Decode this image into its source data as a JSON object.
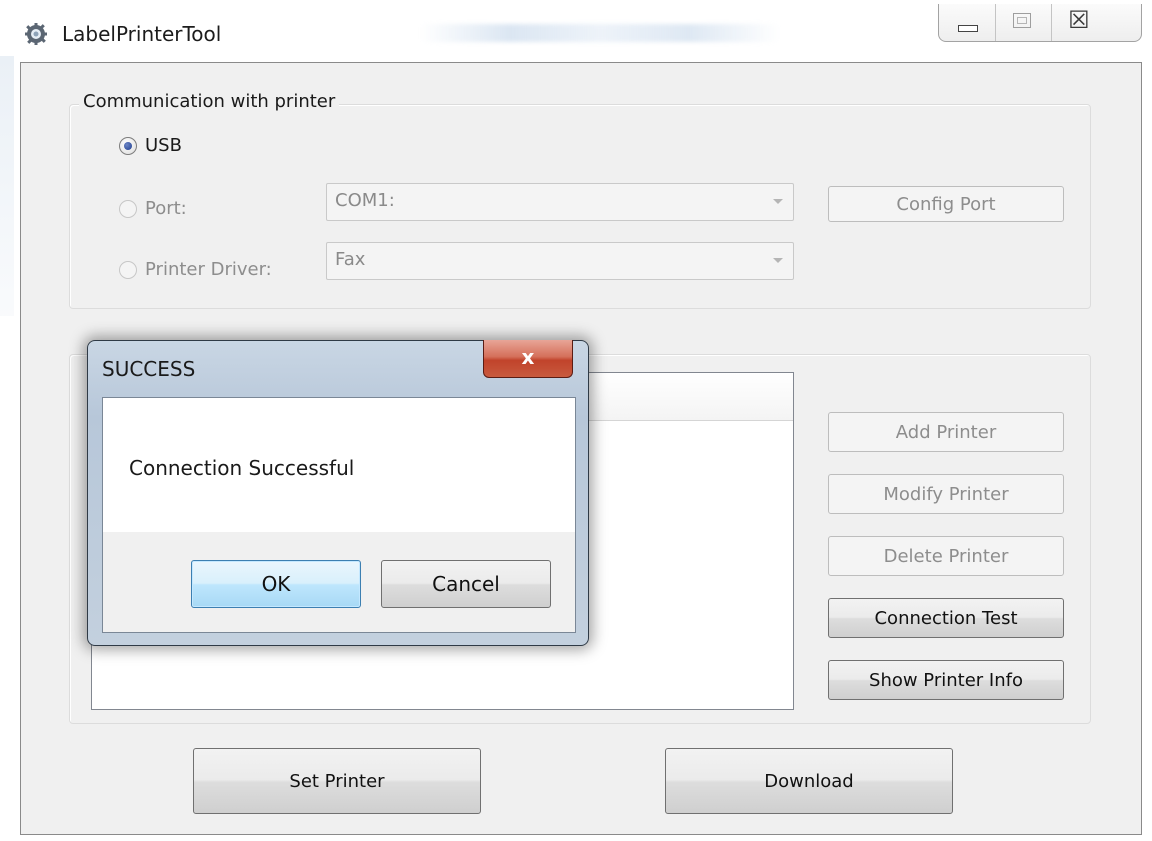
{
  "window": {
    "title": "LabelPrinterTool",
    "icon": "gear-icon",
    "caption_buttons": {
      "minimize_icon": "minimize-icon",
      "maximize_icon": "maximize-icon",
      "close_glyph": "☒"
    }
  },
  "communication": {
    "group_label": "Communication with printer",
    "usb_label": "USB",
    "port_label": "Port:",
    "port_value": "COM1:",
    "driver_label": "Printer Driver:",
    "driver_value": "Fax",
    "config_port_label": "Config Port",
    "selected": "USB"
  },
  "printers": {
    "add_label": "Add Printer",
    "modify_label": "Modify Printer",
    "delete_label": "Delete Printer",
    "connection_test_label": "Connection Test",
    "show_info_label": "Show Printer Info"
  },
  "bottom": {
    "set_printer_label": "Set Printer",
    "download_label": "Download"
  },
  "dialog": {
    "title": "SUCCESS",
    "message": "Connection Successful",
    "ok_label": "OK",
    "cancel_label": "Cancel",
    "close_glyph": "x"
  },
  "colors": {
    "client_bg": "#f0f0f0",
    "dialog_frame": "#b7c7d9",
    "close_red": "#c1432b",
    "ok_blue": "#3c7fb1"
  }
}
